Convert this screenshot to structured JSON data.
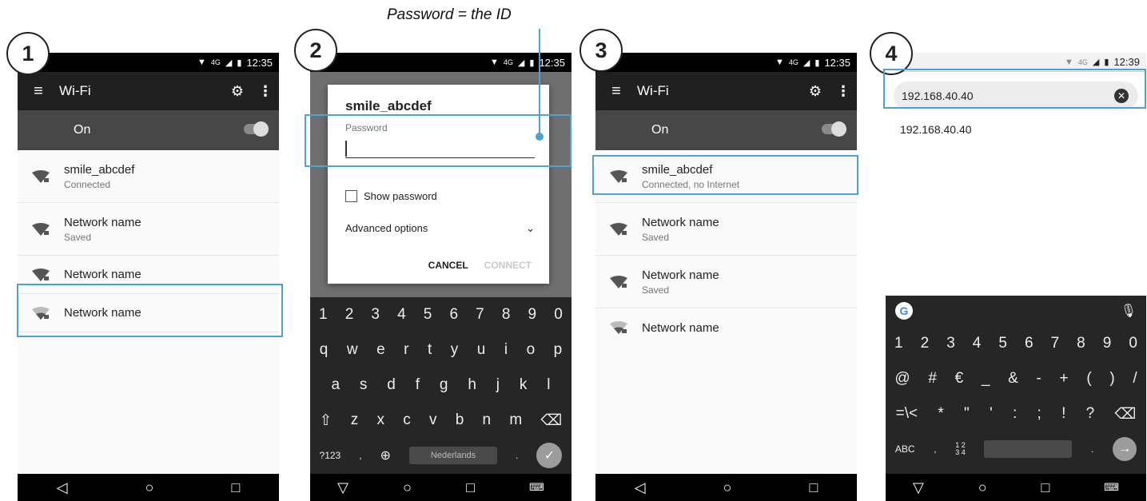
{
  "annotation": "Password = the ID",
  "steps": [
    "1",
    "2",
    "3",
    "4"
  ],
  "colors": {
    "highlight": "#4aa3d4",
    "appbar": "#202020",
    "onbar": "#474747",
    "keyboard": "#262626"
  },
  "phone1": {
    "status": {
      "network": "4G",
      "time": "12:35"
    },
    "appbar": {
      "title": "Wi-Fi"
    },
    "wifi_state": "On",
    "networks": [
      {
        "name": "smile_abcdef",
        "status": "Connected"
      },
      {
        "name": "Network name",
        "status": "Saved"
      },
      {
        "name": "Network name",
        "status": ""
      },
      {
        "name": "Network name",
        "status": ""
      }
    ]
  },
  "phone2": {
    "status": {
      "network": "4G",
      "time": "12:35"
    },
    "dialog": {
      "title": "smile_abcdef",
      "password_label": "Password",
      "show_password": "Show password",
      "advanced": "Advanced options",
      "cancel": "CANCEL",
      "connect": "CONNECT"
    },
    "keyboard": {
      "row1": [
        "1",
        "2",
        "3",
        "4",
        "5",
        "6",
        "7",
        "8",
        "9",
        "0"
      ],
      "row2": [
        "q",
        "w",
        "e",
        "r",
        "t",
        "y",
        "u",
        "i",
        "o",
        "p"
      ],
      "row3": [
        "a",
        "s",
        "d",
        "f",
        "g",
        "h",
        "j",
        "k",
        "l"
      ],
      "row4": [
        "z",
        "x",
        "c",
        "v",
        "b",
        "n",
        "m"
      ],
      "symbols": "?123",
      "space": "Nederlands"
    }
  },
  "phone3": {
    "status": {
      "network": "4G",
      "time": "12:35"
    },
    "appbar": {
      "title": "Wi-Fi"
    },
    "wifi_state": "On",
    "networks": [
      {
        "name": "smile_abcdef",
        "status": "Connected, no Internet"
      },
      {
        "name": "Network name",
        "status": "Saved"
      },
      {
        "name": "Network name",
        "status": "Saved"
      },
      {
        "name": "Network name",
        "status": ""
      }
    ]
  },
  "phone4": {
    "status": {
      "network": "4G",
      "time": "12:39"
    },
    "url": "192.168.40.40",
    "suggestion": "192.168.40.40",
    "keyboard": {
      "row1": [
        "1",
        "2",
        "3",
        "4",
        "5",
        "6",
        "7",
        "8",
        "9",
        "0"
      ],
      "row2": [
        "@",
        "#",
        "€",
        "_",
        "&",
        "-",
        "+",
        "(",
        ")",
        "/"
      ],
      "row3": [
        "=\\<",
        "*",
        "\"",
        "'",
        ":",
        ";",
        "!",
        "?"
      ],
      "abc": "ABC",
      "numpad_top": "1 2",
      "numpad_bottom": "3 4"
    }
  }
}
